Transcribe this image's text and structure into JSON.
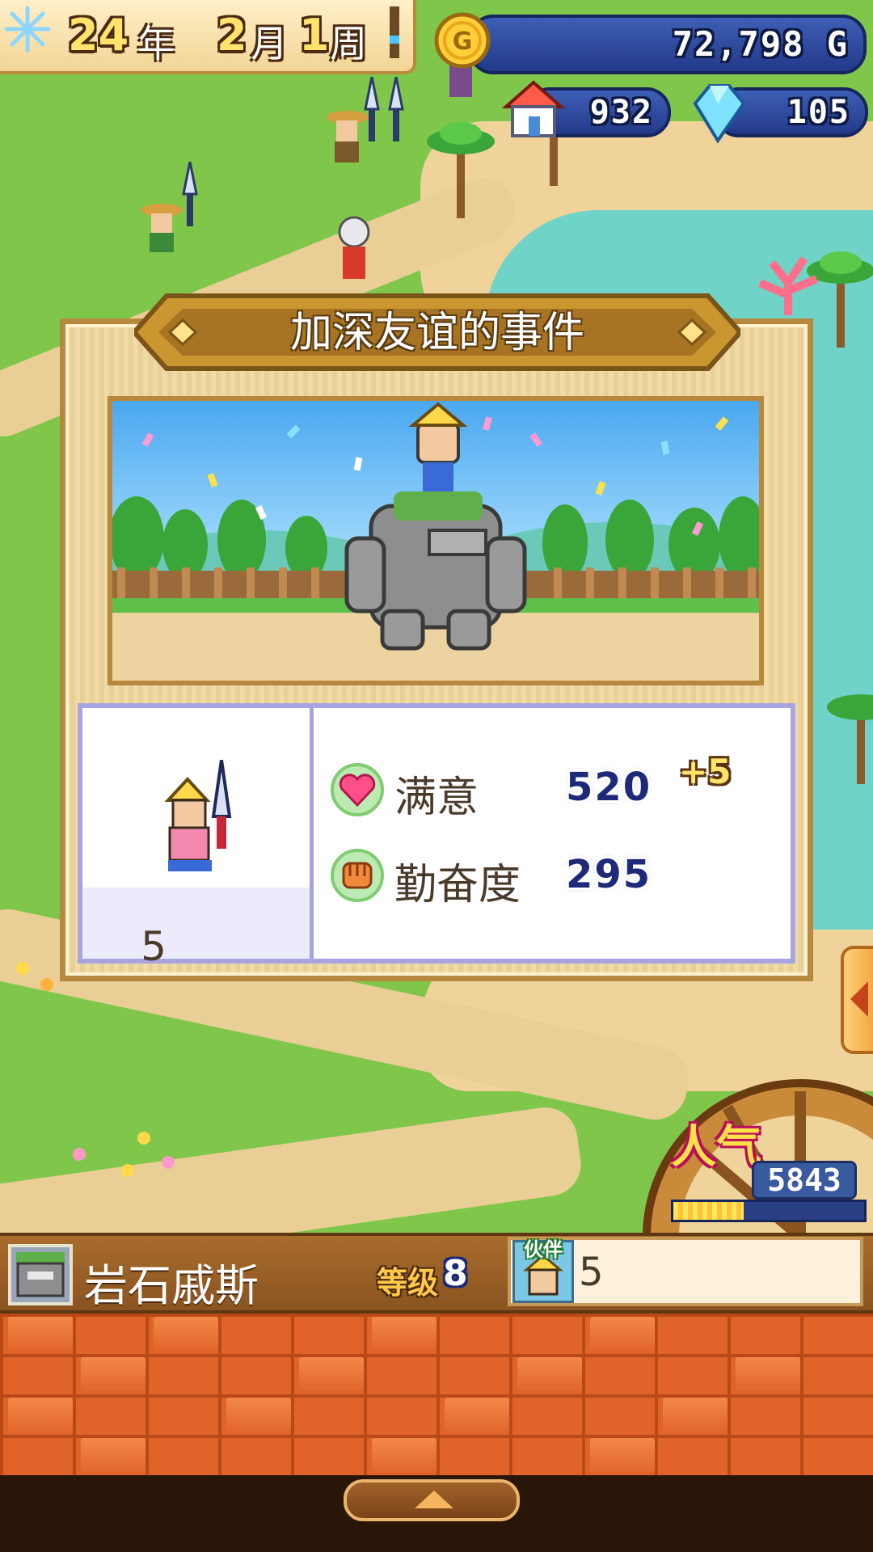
{
  "hud": {
    "date": {
      "year": "24",
      "year_unit": "年",
      "month": "2",
      "month_unit": "月",
      "week": "1",
      "week_unit": "周"
    },
    "gold": {
      "value": "72,798",
      "unit": "G",
      "icon": "gold-coin-icon"
    },
    "houses": {
      "value": "932",
      "icon": "house-icon"
    },
    "crystals": {
      "value": "105",
      "icon": "crystal-icon"
    }
  },
  "dialog": {
    "title": "加深友谊的事件",
    "partner_count": "5",
    "stats": [
      {
        "label": "满意",
        "value": "520",
        "bonus": "+5",
        "icon": "heart-icon",
        "icon_color": "#ff4f8a"
      },
      {
        "label": "勤奋度",
        "value": "295",
        "icon": "fist-icon",
        "icon_color": "#f08a3a"
      }
    ]
  },
  "popularity": {
    "label": "人气",
    "value": "5843",
    "level": 0.37
  },
  "status_bar": {
    "name": "岩石戚斯",
    "level_label": "等级",
    "level_value": "8",
    "partner_tag": "伙伴",
    "partner_value": "5"
  },
  "colors": {
    "accent": "#b7893e",
    "panel_border": "#a8a4e4",
    "sea": "#6fd3c8"
  }
}
